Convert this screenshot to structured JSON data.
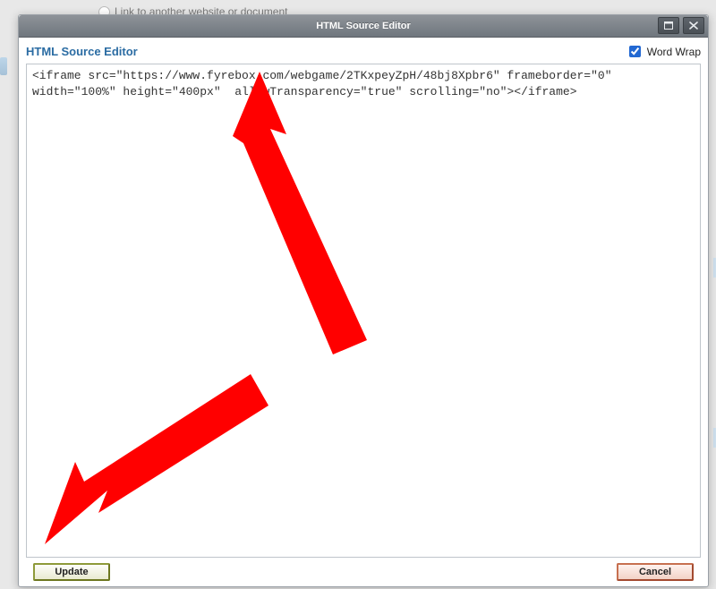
{
  "background": {
    "link_text": "Link to another website or document"
  },
  "modal": {
    "titlebar": {
      "title": "HTML Source Editor"
    },
    "heading": "HTML Source Editor",
    "wordwrap": {
      "label": "Word Wrap",
      "checked": true
    },
    "textarea": {
      "value": "<iframe src=\"https://www.fyrebox.com/webgame/2TKxpeyZpH/48bj8Xpbr6\" frameborder=\"0\" width=\"100%\" height=\"400px\"  allowTransparency=\"true\" scrolling=\"no\"></iframe>"
    },
    "buttons": {
      "update": "Update",
      "cancel": "Cancel"
    }
  }
}
